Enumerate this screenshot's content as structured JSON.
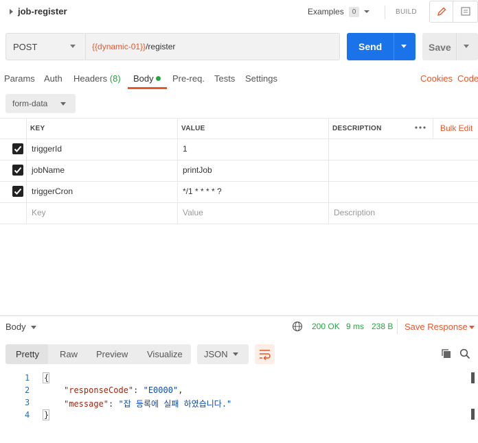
{
  "header": {
    "title": "job-register",
    "examples_label": "Examples",
    "examples_count": "0",
    "build_label": "BUILD"
  },
  "request": {
    "method": "POST",
    "url_variable": "{{dynamic-01}}",
    "url_path": "/register",
    "send_label": "Send",
    "save_label": "Save"
  },
  "tabs": {
    "params": "Params",
    "auth": "Auth",
    "headers": "Headers",
    "headers_count": "(8)",
    "body": "Body",
    "prereq": "Pre-req.",
    "tests": "Tests",
    "settings": "Settings",
    "cookies": "Cookies",
    "code": "Code"
  },
  "body_type": "form-data",
  "table": {
    "columns": [
      "KEY",
      "VALUE",
      "DESCRIPTION"
    ],
    "bulk_edit": "Bulk Edit",
    "rows": [
      {
        "key": "triggerId",
        "value": "1",
        "description": ""
      },
      {
        "key": "jobName",
        "value": "printJob",
        "description": ""
      },
      {
        "key": "triggerCron",
        "value": "*/1 * * * * ?",
        "description": ""
      }
    ],
    "placeholders": {
      "key": "Key",
      "value": "Value",
      "description": "Description"
    }
  },
  "response": {
    "label": "Body",
    "status": "200 OK",
    "time": "9 ms",
    "size": "238 B",
    "save_response": "Save Response",
    "view_tabs": [
      "Pretty",
      "Raw",
      "Preview",
      "Visualize"
    ],
    "format": "JSON",
    "lines": [
      "1",
      "2",
      "3",
      "4"
    ],
    "json": {
      "open": "{",
      "key1": "\"responseCode\"",
      "val1": "\"E0000\"",
      "key2": "\"message\"",
      "val2": "\"잡 등록에 실패 하였습니다.\"",
      "close": "}"
    }
  },
  "colors": {
    "accent": "#e8572a",
    "send": "#1a73e8",
    "success": "#26a540"
  }
}
